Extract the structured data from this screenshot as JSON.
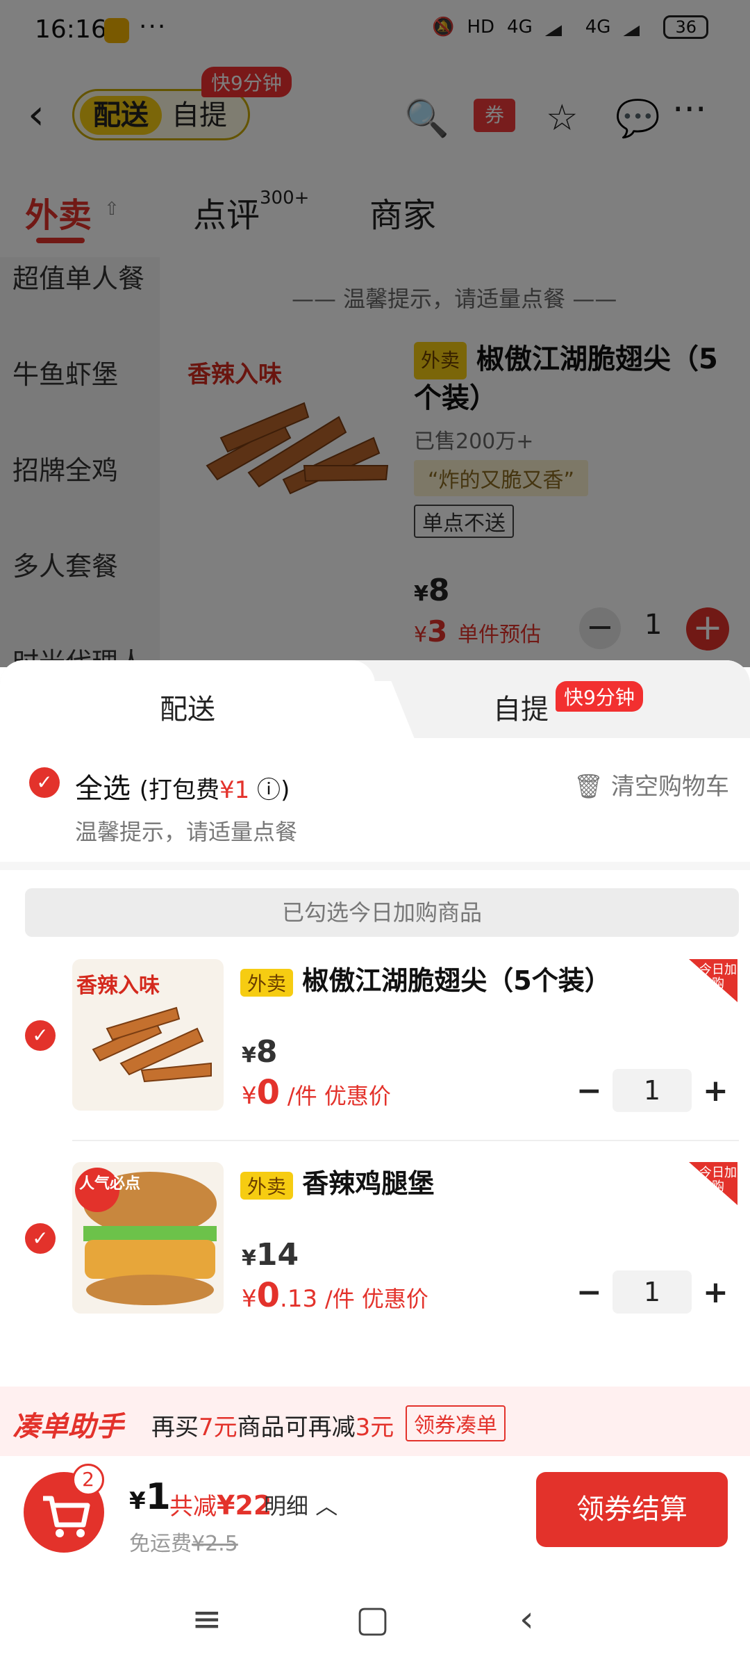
{
  "status": {
    "time": "16:16",
    "hd": "HD",
    "network": "4G",
    "network2": "4G",
    "battery": "36"
  },
  "header": {
    "delivery": "配送",
    "pickup": "自提",
    "fast_badge": "快9分钟",
    "coupon": "券"
  },
  "tabs": [
    {
      "label": "外卖"
    },
    {
      "label": "点评",
      "count": "300+"
    },
    {
      "label": "商家"
    }
  ],
  "left_nav": [
    "超值单人餐",
    "牛鱼虾堡",
    "招牌全鸡",
    "多人套餐",
    "时光代理人"
  ],
  "tip": "温馨提示，请适量点餐",
  "menu_item": {
    "tag": "外卖",
    "name": "椒傲江湖脆翅尖（5个装）",
    "sold": "已售200万+",
    "quote": "“炸的又脆又香”",
    "single_no_ship": "单点不送",
    "price": "8",
    "deal_price": "3",
    "deal_label": "单件预估",
    "qty": "1",
    "img_text": "香辣入味"
  },
  "sheet": {
    "tab_delivery": "配送",
    "tab_pickup": "自提",
    "fast_badge": "快9分钟",
    "select_all": "全选",
    "pack_fee_label": "(打包费",
    "pack_fee": "¥1",
    "pack_fee_end": ")",
    "clear_cart": "清空购物车",
    "tip": "温馨提示，请适量点餐",
    "banner": "已勾选今日加购商品"
  },
  "cart_items": [
    {
      "tag": "外卖",
      "name": "椒傲江湖脆翅尖（5个装）",
      "price": "8",
      "deal_int": "0",
      "deal_dec": "",
      "deal_label": "/件 优惠价",
      "qty": "1",
      "corner": "今日加购",
      "img_text": "香辣入味"
    },
    {
      "tag": "外卖",
      "name": "香辣鸡腿堡",
      "price": "14",
      "deal_int": "0",
      "deal_dec": ".13",
      "deal_label": "/件 优惠价",
      "qty": "1",
      "corner": "今日加购",
      "img_text": "人气必点"
    }
  ],
  "assistant": {
    "title": "凑单助手",
    "text_a": "再买",
    "amount": "7元",
    "text_b": "商品可再减",
    "discount": "3元",
    "button": "领券凑单"
  },
  "footer": {
    "cart_count": "2",
    "total": "1",
    "yen": "¥",
    "save_label": "共减",
    "save_amount": "¥22",
    "detail": "明细",
    "free_ship": "免运费",
    "orig_ship": "¥2.5",
    "checkout": "领券结算"
  },
  "colors": {
    "accent": "#e3322b",
    "yellow": "#f6cc12"
  }
}
